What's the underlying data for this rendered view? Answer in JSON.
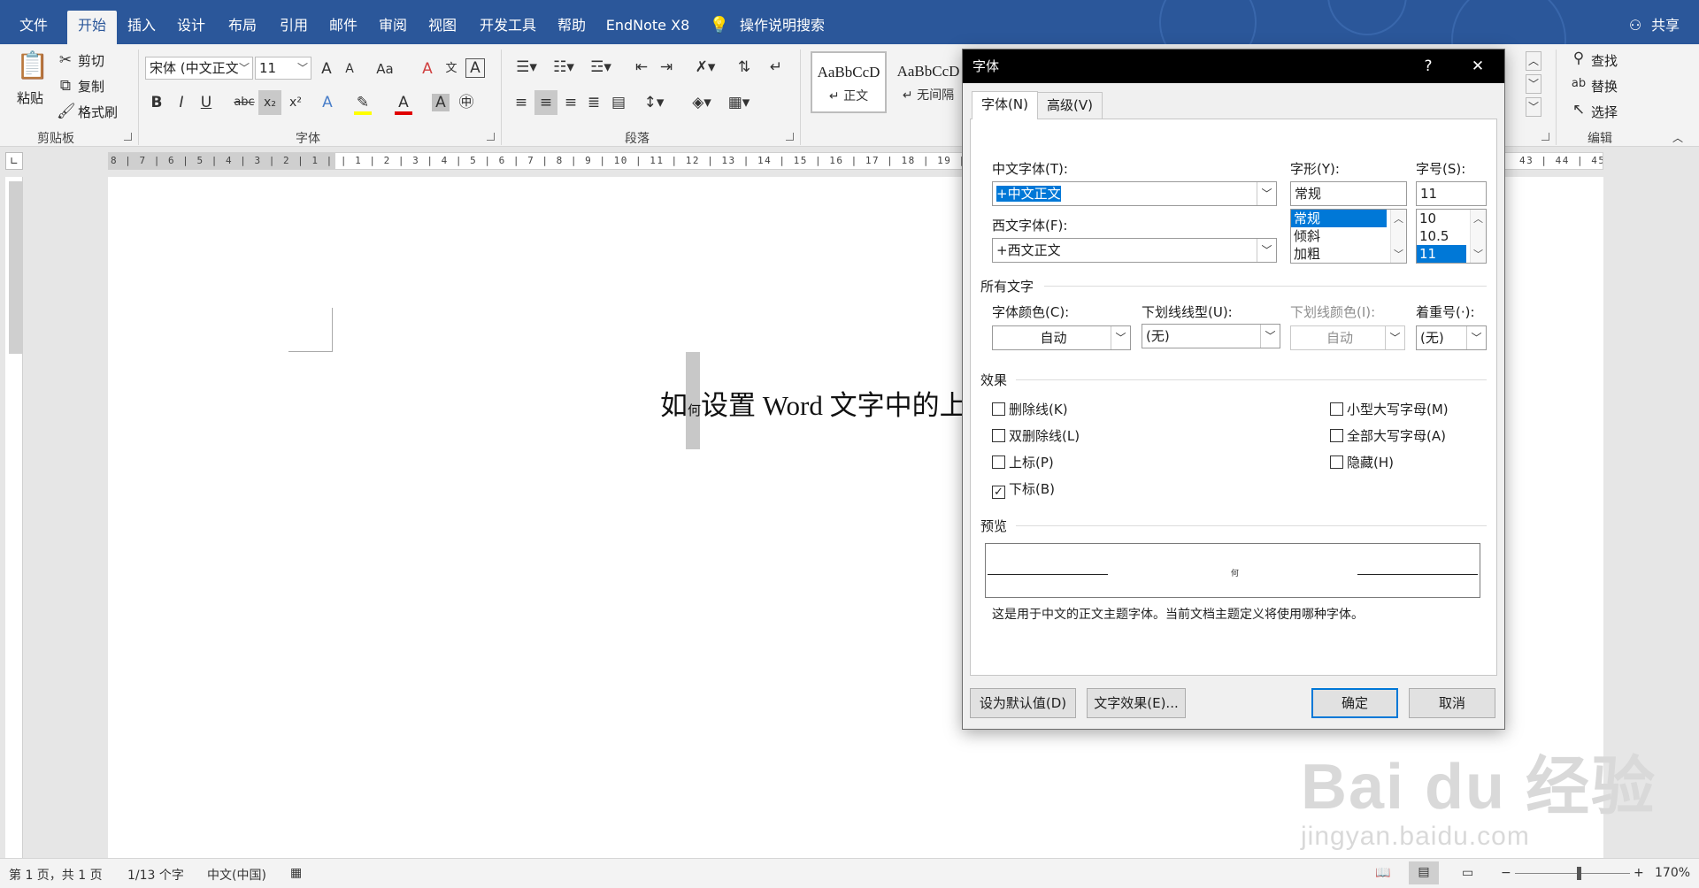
{
  "menu": {
    "tabs": [
      "文件",
      "开始",
      "插入",
      "设计",
      "布局",
      "引用",
      "邮件",
      "审阅",
      "视图",
      "开发工具",
      "帮助",
      "EndNote X8"
    ],
    "active_tab": "开始",
    "tell_me": "操作说明搜索",
    "share": "共享"
  },
  "ribbon": {
    "clipboard": {
      "paste": "粘贴",
      "cut": "剪切",
      "copy": "复制",
      "format_painter": "格式刷",
      "label": "剪贴板"
    },
    "font": {
      "font_name": "宋体 (中文正文",
      "font_size": "11",
      "label": "字体",
      "change_case": "Aa"
    },
    "paragraph": {
      "label": "段落"
    },
    "styles": {
      "style1_sample": "AaBbCcD",
      "style1_name": "正文",
      "style2_sample": "AaBbCcD",
      "style2_name": "无间隔"
    },
    "editing": {
      "find": "查找",
      "replace": "替换",
      "select": "选择",
      "label": "编辑"
    }
  },
  "ruler": {
    "numbers": "8 | 7 | 6 | 5 | 4 | 3 | 2 | 1 |   | 1 | 2 | 3 | 4 | 5 | 6 | 7 | 8 | 9 | 10 | 11 | 12 | 13 | 14 | 15 | 16 | 17 | 18 | 19 | 20 | 21 | 22",
    "numbers_right": "43 | 44 | 45"
  },
  "document": {
    "text_before": "如",
    "subscript_char": "何",
    "text_after": "设置 Word 文字中的上"
  },
  "dialog": {
    "title": "字体",
    "help": "?",
    "close": "✕",
    "tabs": [
      "字体(N)",
      "高级(V)"
    ],
    "chinese_font_label": "中文字体(T):",
    "chinese_font_value": "+中文正文",
    "western_font_label": "西文字体(F):",
    "western_font_value": "+西文正文",
    "style_label": "字形(Y):",
    "style_value": "常规",
    "style_options": [
      "常规",
      "倾斜",
      "加粗"
    ],
    "size_label": "字号(S):",
    "size_value": "11",
    "size_options": [
      "10",
      "10.5",
      "11"
    ],
    "all_text_section": "所有文字",
    "font_color_label": "字体颜色(C):",
    "font_color_value": "自动",
    "underline_style_label": "下划线线型(U):",
    "underline_style_value": "(无)",
    "underline_color_label": "下划线颜色(I):",
    "underline_color_value": "自动",
    "emphasis_label": "着重号(·):",
    "emphasis_value": "(无)",
    "effects_section": "效果",
    "effects_left": [
      {
        "label": "删除线(K)",
        "checked": false
      },
      {
        "label": "双删除线(L)",
        "checked": false
      },
      {
        "label": "上标(P)",
        "checked": false
      },
      {
        "label": "下标(B)",
        "checked": true
      }
    ],
    "effects_right": [
      {
        "label": "小型大写字母(M)",
        "checked": false
      },
      {
        "label": "全部大写字母(A)",
        "checked": false
      },
      {
        "label": "隐藏(H)",
        "checked": false
      }
    ],
    "preview_section": "预览",
    "preview_char": "何",
    "preview_note": "这是用于中文的正文主题字体。当前文档主题定义将使用哪种字体。",
    "btn_default": "设为默认值(D)",
    "btn_text_effects": "文字效果(E)...",
    "btn_ok": "确定",
    "btn_cancel": "取消"
  },
  "status": {
    "page": "第 1 页，共 1 页",
    "words": "1/13 个字",
    "language": "中文(中国)",
    "zoom": "170%"
  },
  "watermark": {
    "brand": "Bai du 经验",
    "url": "jingyan.baidu.com"
  },
  "colors": {
    "accent": "#2b579a",
    "dialog_title": "#000000",
    "selection": "#0078d7"
  }
}
